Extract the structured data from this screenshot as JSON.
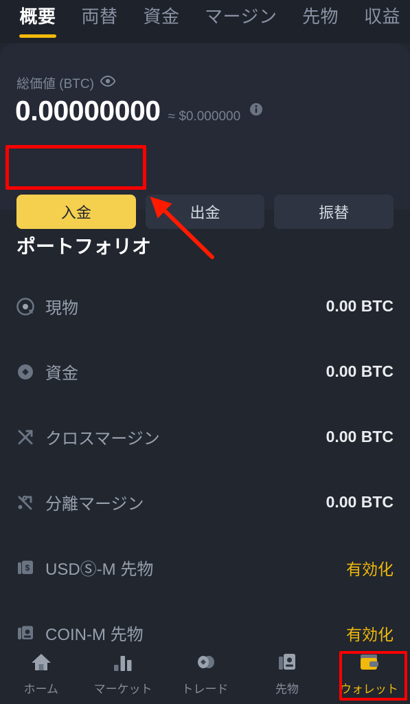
{
  "tabs": [
    {
      "label": "概要",
      "active": true
    },
    {
      "label": "両替",
      "active": false
    },
    {
      "label": "資金",
      "active": false
    },
    {
      "label": "マージン",
      "active": false
    },
    {
      "label": "先物",
      "active": false
    },
    {
      "label": "収益",
      "active": false
    }
  ],
  "balance": {
    "label": "総価値 (BTC)",
    "eye_icon": "eye-icon",
    "value": "0.00000000",
    "approx": "≈ $0.000000",
    "info_icon": "info-icon"
  },
  "actions": [
    {
      "label": "入金",
      "primary": true
    },
    {
      "label": "出金",
      "primary": false
    },
    {
      "label": "振替",
      "primary": false
    }
  ],
  "portfolio": {
    "title": "ポートフォリオ",
    "rows": [
      {
        "icon": "spot-icon",
        "name": "現物",
        "value": "0.00 BTC",
        "enable": false
      },
      {
        "icon": "funding-icon",
        "name": "資金",
        "value": "0.00 BTC",
        "enable": false
      },
      {
        "icon": "cross-margin-icon",
        "name": "クロスマージン",
        "value": "0.00 BTC",
        "enable": false
      },
      {
        "icon": "isolated-margin-icon",
        "name": "分離マージン",
        "value": "0.00 BTC",
        "enable": false
      },
      {
        "icon": "usds-m-futures-icon",
        "name": "USDⓈ-M 先物",
        "value": "有効化",
        "enable": true
      },
      {
        "icon": "coin-m-futures-icon",
        "name": "COIN-M 先物",
        "value": "有効化",
        "enable": true
      }
    ]
  },
  "bottom_nav": [
    {
      "icon": "home-icon",
      "label": "ホーム",
      "active": false
    },
    {
      "icon": "market-icon",
      "label": "マーケット",
      "active": false
    },
    {
      "icon": "trade-icon",
      "label": "トレード",
      "active": false
    },
    {
      "icon": "futures-icon",
      "label": "先物",
      "active": false
    },
    {
      "icon": "wallet-icon",
      "label": "ウォレット",
      "active": true
    }
  ],
  "annotations": {
    "color": "#ff0000",
    "highlight_deposit_button": "入金",
    "highlight_wallet_tab": "ウォレット",
    "arrow": "arrow-pointing-to-deposit-button"
  },
  "colors": {
    "accent": "#f0b90b",
    "primary_button": "#f5d04e",
    "page_background": "#21262f",
    "card_background": "#252a36",
    "header_background": "#1e222b",
    "annotation": "#ff0000"
  }
}
